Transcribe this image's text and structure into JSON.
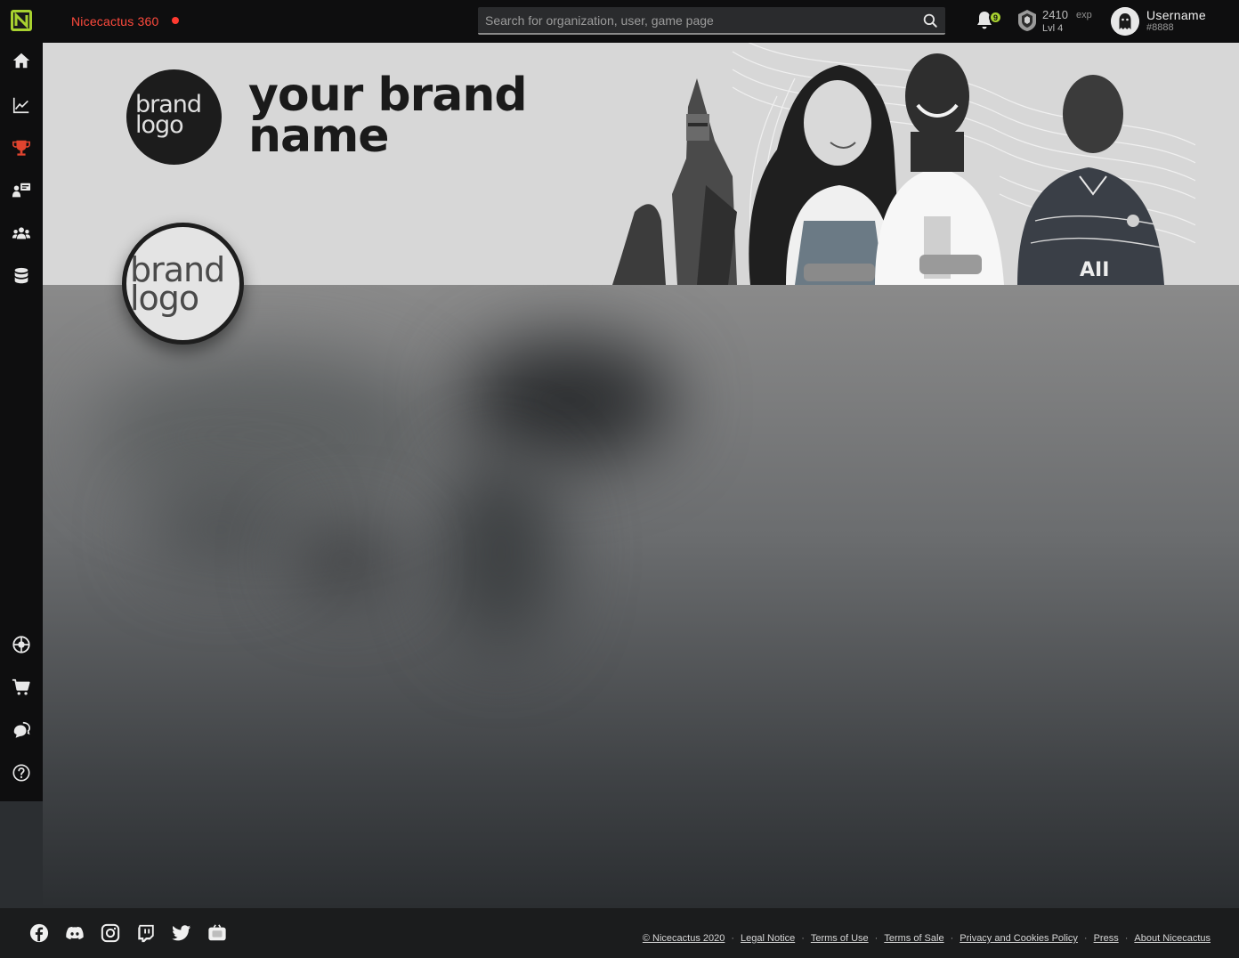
{
  "topbar": {
    "app_name": "Nicecactus 360",
    "search_placeholder": "Search for organization, user, game page",
    "notifications_count": "9",
    "exp_value": "2410",
    "exp_unit": "exp",
    "level": "Lvl 4",
    "username": "Username",
    "usertag": "#8888"
  },
  "sidebar": {
    "items": [
      {
        "icon": "home-icon"
      },
      {
        "icon": "stats-chart-icon"
      },
      {
        "icon": "trophy-icon",
        "color": "#e0442f"
      },
      {
        "icon": "coaching-icon"
      },
      {
        "icon": "community-icon"
      },
      {
        "icon": "database-icon"
      },
      {
        "icon": "esports-globe-icon"
      },
      {
        "icon": "cart-icon"
      },
      {
        "icon": "chat-icon"
      },
      {
        "icon": "help-icon"
      }
    ]
  },
  "banner": {
    "logo_line1": "brand",
    "logo_line2": "logo",
    "brand_name_line1": "your brand",
    "brand_name_line2": "name"
  },
  "profile": {
    "logo_line1": "brand",
    "logo_line2": "logo"
  },
  "footer": {
    "social": [
      "facebook-icon",
      "discord-icon",
      "instagram-icon",
      "twitch-icon",
      "twitter-icon",
      "nicecactus-tv-icon"
    ],
    "links": [
      "© Nicecactus 2020",
      "Legal Notice",
      "Terms of Use",
      "Terms of Sale",
      "Privacy and Cookies Policy",
      "Press",
      "About Nicecactus"
    ]
  },
  "colors": {
    "accent_green": "#a8d12f",
    "live_red": "#ff3a30",
    "trophy_red": "#e0442f"
  }
}
